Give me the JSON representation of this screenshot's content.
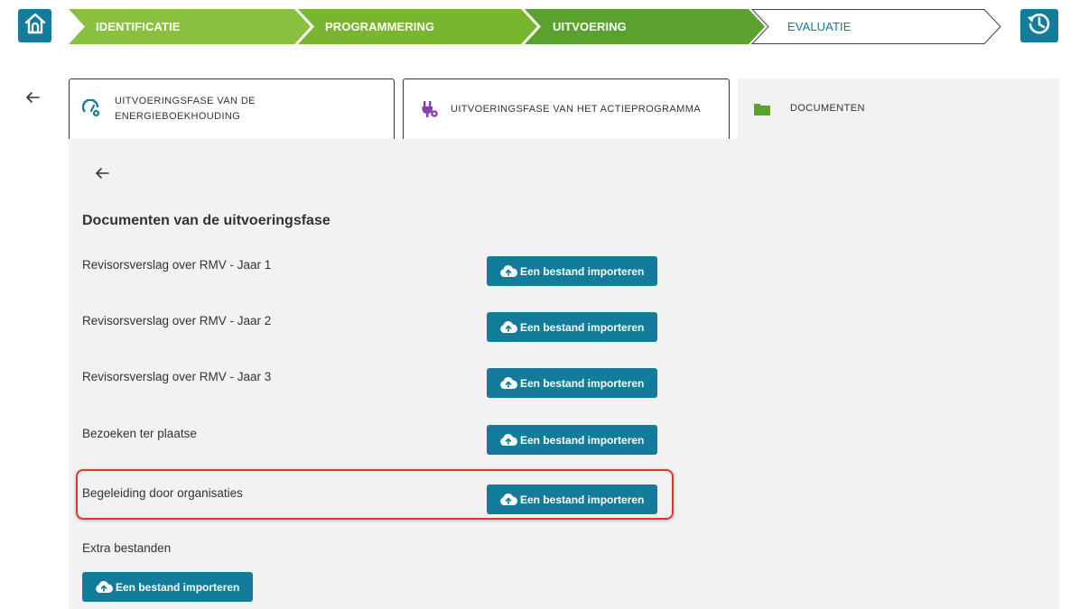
{
  "nav": {
    "home_icon": "home-icon",
    "history_icon": "history-icon",
    "steps": [
      {
        "label": "IDENTIFICATIE",
        "state": "done",
        "color": "#8ac03f"
      },
      {
        "label": "PROGRAMMERING",
        "state": "done",
        "color": "#79b52e"
      },
      {
        "label": "UITVOERING",
        "state": "current",
        "color": "#5aa22d"
      },
      {
        "label": "EVALUATIE",
        "state": "future",
        "color": "#137c9a"
      }
    ]
  },
  "tabs": [
    {
      "label": "UITVOERINGSFASE VAN DE ENERGIEBOEKHOUDING",
      "icon": "gauge-settings-icon"
    },
    {
      "label": "UITVOERINGSFASE VAN HET ACTIEPROGRAMMA",
      "icon": "plug-settings-icon"
    },
    {
      "label": "DOCUMENTEN",
      "icon": "folder-icon"
    }
  ],
  "panel": {
    "title": "Documenten van de uitvoeringsfase",
    "documents": [
      {
        "label": "Revisorsverslag over RMV - Jaar 1",
        "button": "Een bestand importeren"
      },
      {
        "label": "Revisorsverslag over RMV - Jaar 2",
        "button": "Een bestand importeren"
      },
      {
        "label": "Revisorsverslag over RMV - Jaar 3",
        "button": "Een bestand importeren"
      },
      {
        "label": "Bezoeken ter plaatse",
        "button": "Een bestand importeren"
      },
      {
        "label": "Begeleiding door organisaties",
        "button": "Een bestand importeren"
      }
    ],
    "extra": {
      "label": "Extra bestanden",
      "button": "Een bestand importeren"
    }
  },
  "colors": {
    "primary": "#137c9a",
    "highlight": "#e8312f",
    "panel_bg": "#f2f2f2"
  }
}
